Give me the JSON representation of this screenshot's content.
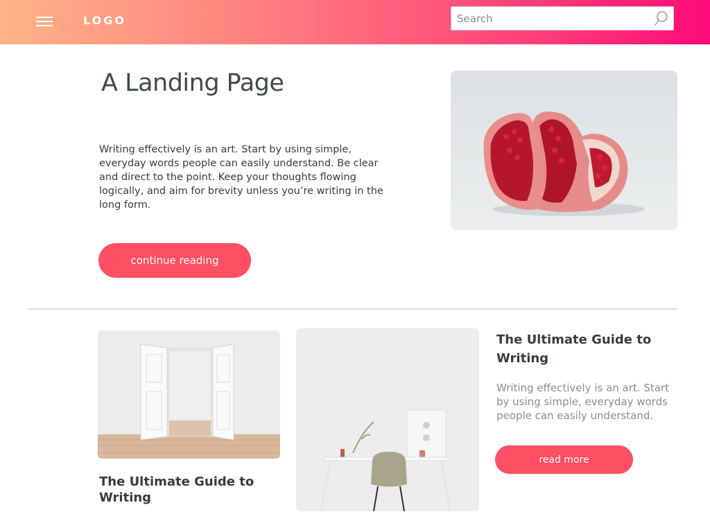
{
  "header": {
    "logo": "LOGO",
    "search": {
      "placeholder": "Search",
      "value": ""
    },
    "icons": {
      "menu": "hamburger-menu-icon",
      "search": "search-icon"
    }
  },
  "hero": {
    "title": "A Landing Page",
    "text": "Writing effectively is an art. Start by using simple, everyday words people can easily understand. Be clear and direct to the point. Keep your thoughts flowing logically, and aim for brevity unless you’re writing in the long form.",
    "button_label": "continue reading",
    "image": "pomegranate-photo"
  },
  "cards": [
    {
      "title": "The Ultimate Guide to Writing",
      "image": "open-doors-room-photo"
    },
    {
      "image": "desk-chair-photo"
    },
    {
      "title": "The Ultimate Guide to Writing",
      "text": "Writing effectively is an art. Start by using simple, everyday words people can easily understand.",
      "button_label": "read more"
    }
  ],
  "colors": {
    "header_gradient": [
      "#ffb387",
      "#ff7a7e",
      "#ff3f78",
      "#ff0a78"
    ],
    "accent": "#ff4f64"
  }
}
